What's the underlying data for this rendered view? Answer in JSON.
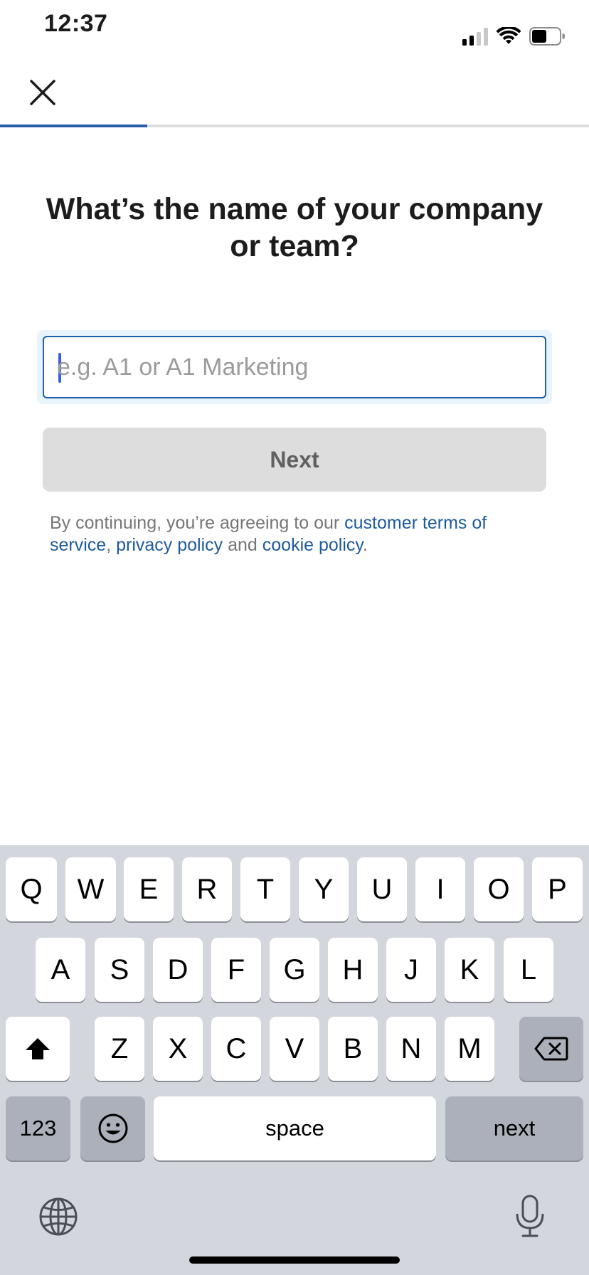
{
  "status_bar": {
    "time": "12:37",
    "battery_level": 0.55
  },
  "nav": {
    "progress": 0.25
  },
  "heading": "What’s the name of your company or team?",
  "company_input": {
    "placeholder": "e.g. A1 or A1 Marketing",
    "value": ""
  },
  "next_button": {
    "label": "Next"
  },
  "legal": {
    "prefix": "By continuing, you’re agreeing to our ",
    "terms_link": "customer terms of service",
    "comma": ", ",
    "privacy_link": "privacy policy",
    "and": " and ",
    "cookie_link": "cookie policy",
    "suffix": "."
  },
  "keyboard": {
    "row1": [
      "Q",
      "W",
      "E",
      "R",
      "T",
      "Y",
      "U",
      "I",
      "O",
      "P"
    ],
    "row2": [
      "A",
      "S",
      "D",
      "F",
      "G",
      "H",
      "J",
      "K",
      "L"
    ],
    "row3": [
      "Z",
      "X",
      "C",
      "V",
      "B",
      "N",
      "M"
    ],
    "numbers_key": "123",
    "space_key": "space",
    "return_key": "next"
  },
  "colors": {
    "accent": "#1f5ea8",
    "link": "#1e5a9c",
    "progress": "#2c5ea8"
  },
  "icons": [
    "close-icon",
    "signal-icon",
    "wifi-icon",
    "battery-icon",
    "shift-icon",
    "delete-icon",
    "emoji-icon",
    "globe-icon",
    "microphone-icon"
  ]
}
